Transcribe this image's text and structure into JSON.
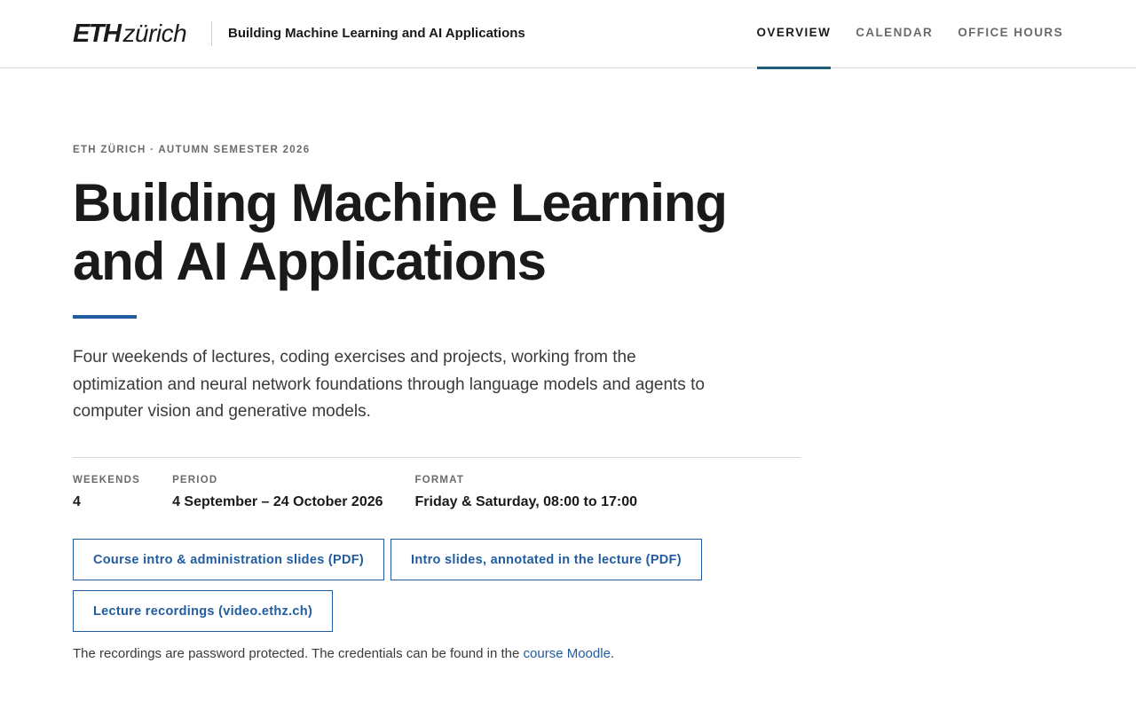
{
  "header": {
    "logo": {
      "primary": "ETH",
      "secondary": "zürich"
    },
    "course_title": "Building Machine Learning and AI Applications",
    "nav": [
      {
        "label": "Overview",
        "active": true
      },
      {
        "label": "Calendar",
        "active": false
      },
      {
        "label": "Office Hours",
        "active": false
      }
    ]
  },
  "hero": {
    "eyebrow": "ETH Zürich · Autumn Semester 2026",
    "title": "Building Machine Learning and AI Applications",
    "lead": "Four weekends of lectures, coding exercises and projects, working from the optimization and neural network foundations through language models and agents to computer vision and generative models."
  },
  "facts": [
    {
      "label": "Weekends",
      "value": "4"
    },
    {
      "label": "Period",
      "value": "4 September – 24 October 2026"
    },
    {
      "label": "Format",
      "value": "Friday & Saturday, 08:00 to 17:00"
    }
  ],
  "links": {
    "intro_slides": "Course intro & administration slides (PDF)",
    "annotated_slides": "Intro slides, annotated in the lecture (PDF)",
    "recordings": "Lecture recordings (video.ethz.ch)"
  },
  "note": {
    "text": "The recordings are password protected. The credentials can be found in the ",
    "link": "course Moodle",
    "suffix": "."
  },
  "colors": {
    "accent": "#215ca0",
    "nav_indicator": "#215c7b",
    "text": "#1a1a1a",
    "muted": "#6b6b6b"
  }
}
